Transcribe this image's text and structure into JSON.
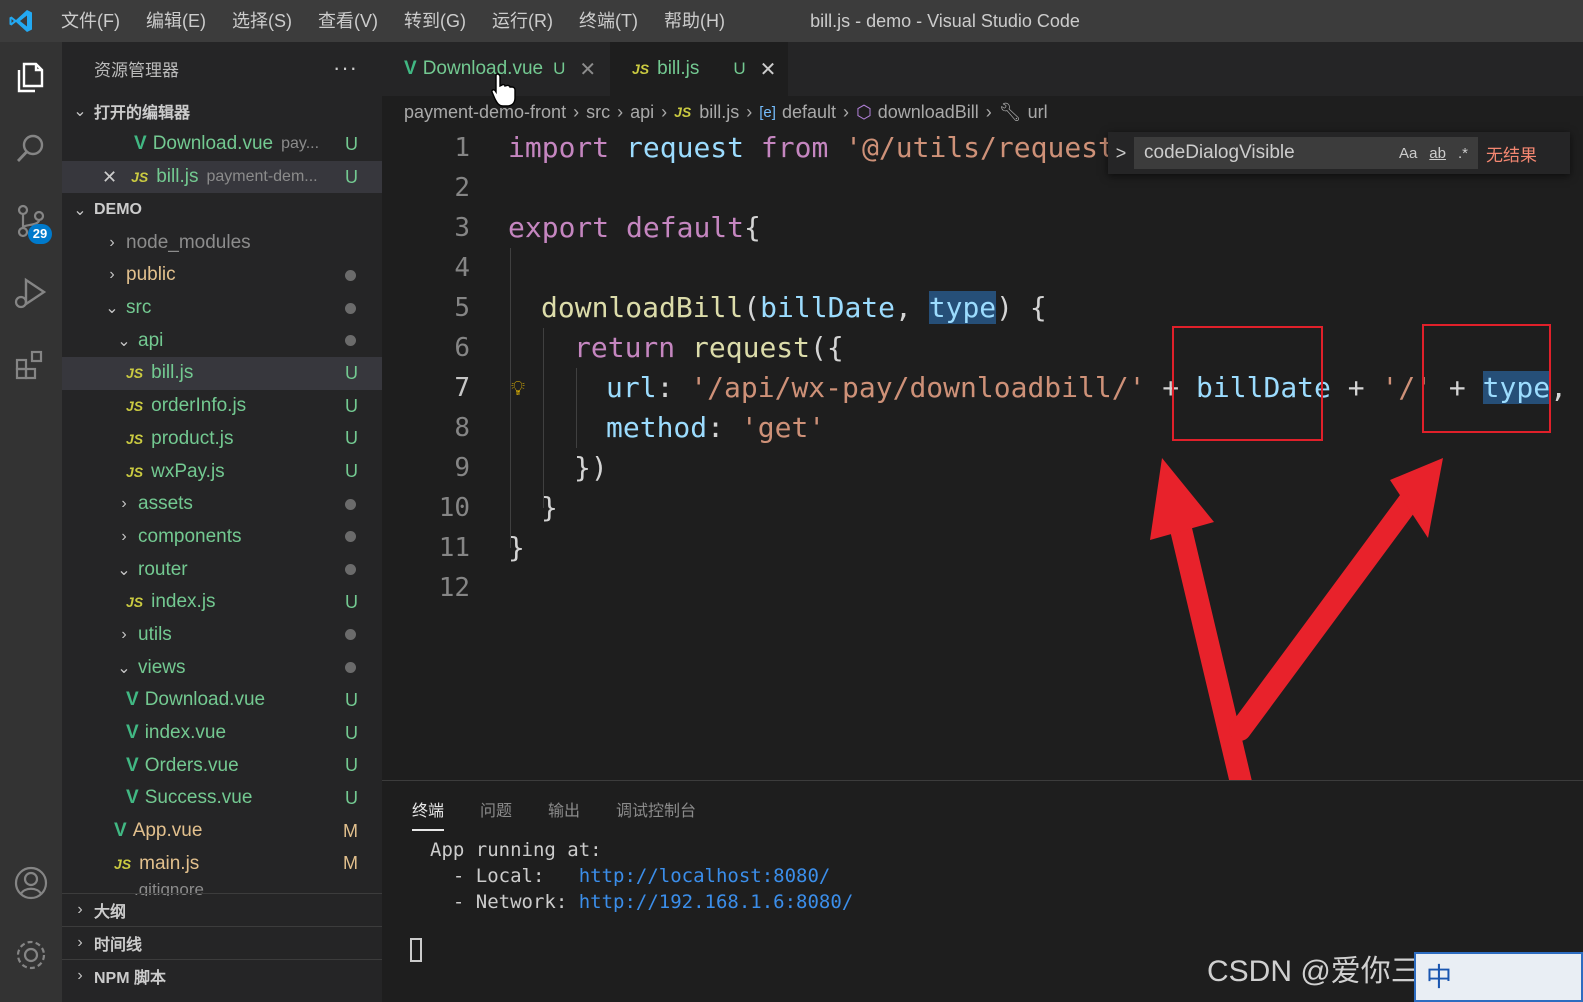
{
  "titlebar": {
    "menu": [
      "文件(F)",
      "编辑(E)",
      "选择(S)",
      "查看(V)",
      "转到(G)",
      "运行(R)",
      "终端(T)",
      "帮助(H)"
    ],
    "title": "bill.js - demo - Visual Studio Code"
  },
  "activitybar": {
    "icons": [
      "explorer-icon",
      "search-icon",
      "source-control-icon",
      "run-debug-icon",
      "extensions-icon",
      "account-icon",
      "settings-gear-icon"
    ],
    "scm_badge": "29"
  },
  "sidebar": {
    "header": "资源管理器",
    "more": "···",
    "open_editors_title": "打开的编辑器",
    "open_editors": [
      {
        "name": "Download.vue",
        "path": "pay...",
        "status": "U"
      },
      {
        "name": "bill.js",
        "path": "payment-dem...",
        "status": "U"
      }
    ],
    "project_title": "DEMO",
    "tree": [
      {
        "name": "node_modules"
      },
      {
        "name": "public"
      },
      {
        "name": "src"
      },
      {
        "name": "api"
      },
      {
        "name": "bill.js",
        "status": "U"
      },
      {
        "name": "orderInfo.js",
        "status": "U"
      },
      {
        "name": "product.js",
        "status": "U"
      },
      {
        "name": "wxPay.js",
        "status": "U"
      },
      {
        "name": "assets"
      },
      {
        "name": "components"
      },
      {
        "name": "router"
      },
      {
        "name": "index.js",
        "status": "U"
      },
      {
        "name": "utils"
      },
      {
        "name": "views"
      },
      {
        "name": "Download.vue",
        "status": "U"
      },
      {
        "name": "index.vue",
        "status": "U"
      },
      {
        "name": "Orders.vue",
        "status": "U"
      },
      {
        "name": "Success.vue",
        "status": "U"
      },
      {
        "name": "App.vue",
        "status": "M"
      },
      {
        "name": "main.js",
        "status": "M"
      },
      {
        "name": ".gitignore"
      }
    ],
    "bottom_sections": [
      "大纲",
      "时间线",
      "NPM 脚本"
    ]
  },
  "tabs": [
    {
      "label": "Download.vue",
      "status": "U",
      "close": "✕"
    },
    {
      "label": "bill.js",
      "status": "U",
      "close": "✕"
    }
  ],
  "breadcrumb": [
    "payment-demo-front",
    "src",
    "api",
    "bill.js",
    "default",
    "downloadBill",
    "url"
  ],
  "editor": {
    "line_numbers": [
      "1",
      "2",
      "3",
      "4",
      "5",
      "6",
      "7",
      "8",
      "9",
      "10",
      "11",
      "12"
    ],
    "line1": [
      "import",
      " request ",
      "from",
      " '@/utils/request'"
    ],
    "line3": [
      "export",
      " default",
      "{"
    ],
    "line5": [
      "downloadBill",
      "(",
      "billDate",
      ", ",
      "type",
      ") {"
    ],
    "line6": [
      "return",
      " request",
      "({"
    ],
    "line7": [
      "url",
      ": ",
      "'/api/wx-pay/downloadbill/'",
      " + ",
      "billDate",
      " + ",
      "'/'",
      " + ",
      "type",
      ","
    ],
    "line8": [
      "method",
      ": ",
      "'get'"
    ],
    "line9": "})",
    "line10": "}",
    "line11": "}"
  },
  "find_widget": {
    "toggle": ">",
    "query": "codeDialogVisible",
    "opt_case": "Aa",
    "opt_word": "ab",
    "opt_regex": ".*",
    "result": "无结果"
  },
  "panel": {
    "tabs": [
      "终端",
      "问题",
      "输出",
      "调试控制台"
    ],
    "terminal": {
      "line1": "App running at:",
      "local_label": "  - Local:   ",
      "local_url": "http://localhost:8080/",
      "network_label": "  - Network: ",
      "network_url": "http://192.168.1.6:8080/"
    }
  },
  "watermark": "CSDN @爱你三千遍斯塔克",
  "ime": "中",
  "colors": {
    "annotation_red": "#e0202a",
    "accent": "#007acc",
    "untracked": "#73c991",
    "modified": "#e2c08d"
  }
}
